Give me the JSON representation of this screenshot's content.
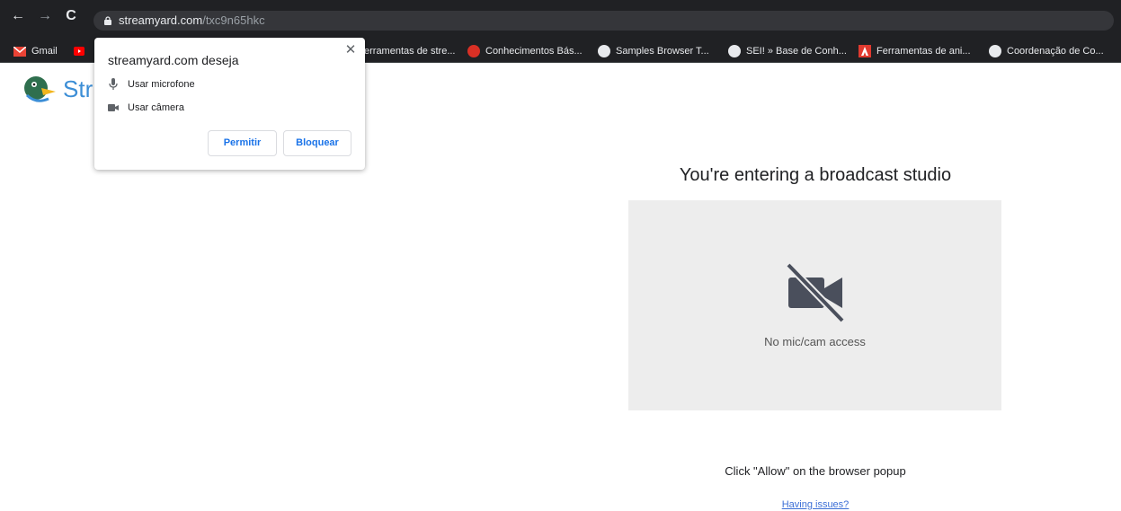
{
  "browser": {
    "url_domain": "streamyard.com",
    "url_path": "/txc9n65hkc",
    "bookmarks": [
      {
        "label": "Gmail",
        "color": "#ea4335"
      },
      {
        "label": "erramentas de stre...",
        "color": "#888888"
      },
      {
        "label": "Conhecimentos Bás...",
        "color": "#d93025"
      },
      {
        "label": "Samples Browser T...",
        "color": "#e8eaed"
      },
      {
        "label": "SEI! » Base de Conh...",
        "color": "#e8eaed"
      },
      {
        "label": "Ferramentas de ani...",
        "color": "#e03a2f"
      },
      {
        "label": "Coordenação de Co...",
        "color": "#e8eaed"
      }
    ]
  },
  "page": {
    "logo_text": "Str",
    "studio_title": "You're entering a broadcast studio",
    "no_access_text": "No mic/cam access",
    "allow_hint": "Click \"Allow\" on the browser popup",
    "issues_link": "Having issues?"
  },
  "popup": {
    "title": "streamyard.com deseja",
    "permissions": [
      "Usar microfone",
      "Usar câmera"
    ],
    "allow_label": "Permitir",
    "block_label": "Bloquear",
    "close_symbol": "✕"
  },
  "colors": {
    "chrome_bg": "#202124",
    "accent_blue": "#1a73e8",
    "logo_blue": "#3c8ed6"
  }
}
